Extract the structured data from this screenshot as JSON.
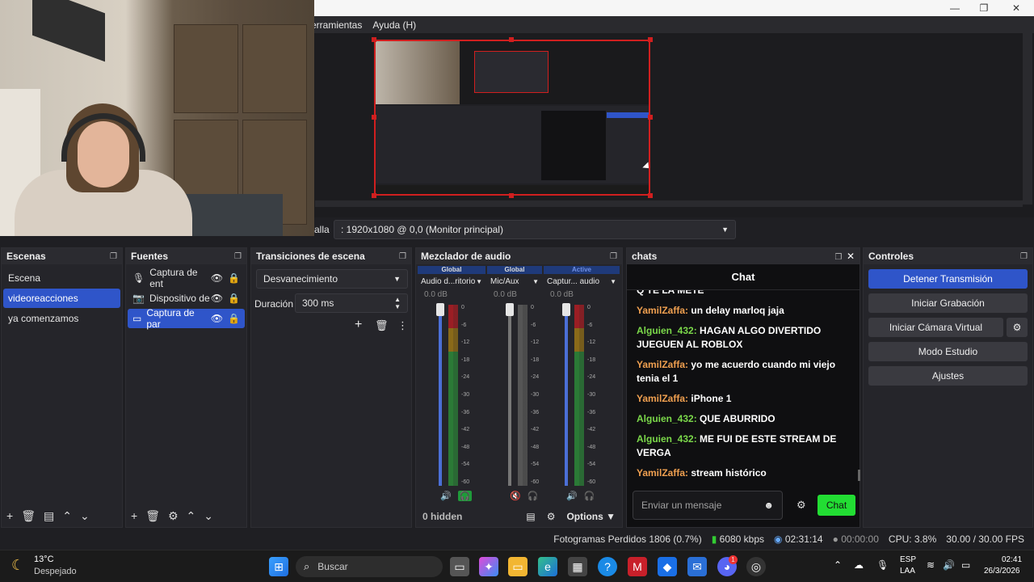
{
  "window": {
    "minimize": "—",
    "maximize": "❐",
    "close": "✕"
  },
  "menu": {
    "tools": "erramientas",
    "help": "Ayuda (H)"
  },
  "source_bar": {
    "label": "alla",
    "monitor_value": ": 1920x1080 @ 0,0 (Monitor principal)"
  },
  "scenes": {
    "title": "Escenas",
    "items": [
      {
        "label": "Escena"
      },
      {
        "label": "videoreacciones"
      },
      {
        "label": "ya comenzamos"
      }
    ]
  },
  "sources": {
    "title": "Fuentes",
    "items": [
      {
        "label": "Captura de ent",
        "icon": "microphone-icon"
      },
      {
        "label": "Dispositivo de",
        "icon": "camera-icon"
      },
      {
        "label": "Captura de par",
        "icon": "monitor-icon"
      }
    ]
  },
  "transitions": {
    "title": "Transiciones de escena",
    "selected": "Desvanecimiento",
    "duration_label": "Duración",
    "duration_value": "300 ms"
  },
  "mixer": {
    "title": "Mezclador de audio",
    "channels": [
      {
        "header": "Global",
        "name": "Audio d...ritorio",
        "db": "0.0 dB",
        "level": 0.0
      },
      {
        "header": "Global",
        "name": "Mic/Aux",
        "db": "0.0 dB",
        "level": 0.0
      },
      {
        "header": "Active",
        "name": "Captur... audio",
        "db": "0.0 dB",
        "level": 0.0
      }
    ],
    "ticks": [
      "0",
      "-6",
      "-12",
      "-18",
      "-24",
      "-30",
      "-36",
      "-42",
      "-48",
      "-54",
      "-60"
    ],
    "hidden": "0 hidden",
    "options": "Options"
  },
  "chats": {
    "dock_title": "chats",
    "header": "Chat",
    "partial_top": "Q TE LA METE",
    "messages": [
      {
        "user": "YamilZaffa:",
        "text": " un delay marloq jaja",
        "color": "#f0a050"
      },
      {
        "user": "Alguien_432:",
        "text": " HAGAN ALGO DIVERTIDO JUEGUEN AL ROBLOX",
        "color": "#7bd84a"
      },
      {
        "user": "YamilZaffa:",
        "text": " yo me acuerdo cuando mi viejo tenia el 1",
        "color": "#f0a050"
      },
      {
        "user": "YamilZaffa:",
        "text": " iPhone 1",
        "color": "#f0a050"
      },
      {
        "user": "Alguien_432:",
        "text": " QUE ABURRIDO",
        "color": "#7bd84a"
      },
      {
        "user": "Alguien_432:",
        "text": " ME FUI DE ESTE STREAM DE VERGA",
        "color": "#7bd84a"
      },
      {
        "user": "YamilZaffa:",
        "text": " stream histórico",
        "color": "#f0a050"
      }
    ],
    "input_placeholder": "Enviar un mensaje",
    "send_label": "Chat"
  },
  "controls": {
    "title": "Controles",
    "stop_stream": "Detener Transmisión",
    "start_recording": "Iniciar Grabación",
    "start_virtual_cam": "Iniciar Cámara Virtual",
    "studio_mode": "Modo Estudio",
    "settings": "Ajustes"
  },
  "status": {
    "dropped_frames": "Fotogramas Perdidos 1806 (0.7%)",
    "bitrate": "6080 kbps",
    "stream_time": "02:31:14",
    "rec_time": "00:00:00",
    "cpu": "CPU: 3.8%",
    "fps": "30.00 / 30.00 FPS"
  },
  "taskbar": {
    "weather_temp": "13°C",
    "weather_desc": "Despejado",
    "search_placeholder": "Buscar",
    "lang_top": "ESP",
    "lang_bottom": "LAA",
    "time": "02:41",
    "date": "26/3/2026",
    "discord_badge": "1"
  }
}
